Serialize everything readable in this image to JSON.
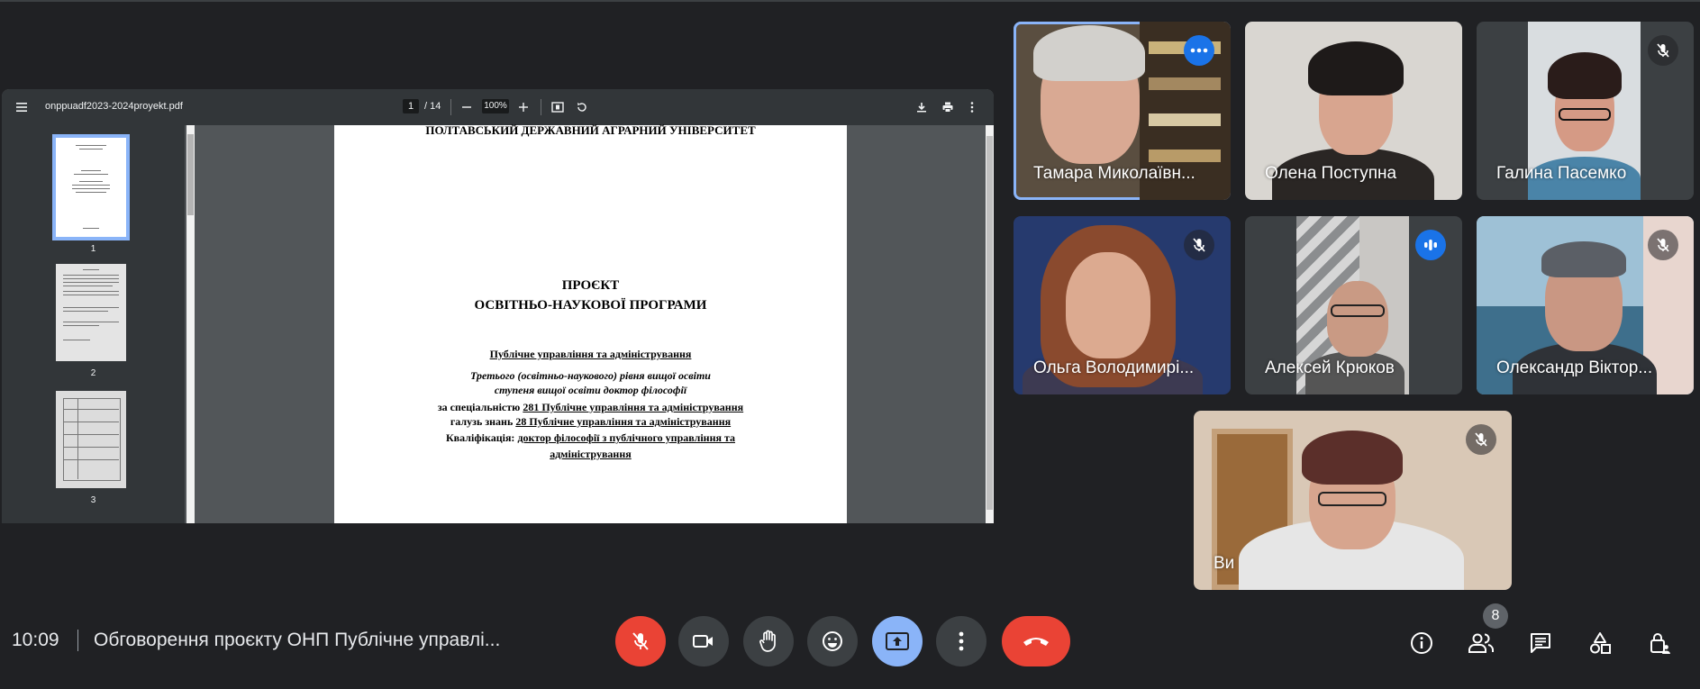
{
  "pdf": {
    "filename": "onppuadf2023-2024proyekt.pdf",
    "current_page": "1",
    "total_pages": "/ 14",
    "zoom": "100%",
    "thumbnails": [
      {
        "label": "1"
      },
      {
        "label": "2"
      },
      {
        "label": "3"
      }
    ],
    "document": {
      "university": "ПОЛТАВСЬКИЙ ДЕРЖАВНИЙ АГРАРНИЙ УНІВЕРСИТЕТ",
      "title_1": "ПРОЄКТ",
      "title_2": "ОСВІТНЬО-НАУКОВОЇ ПРОГРАМИ",
      "program": "Публічне управління та адміністрування",
      "level_1": "Третього (освітньо-наукового) рівня вищої освіти",
      "level_2": "ступеня вищої освіти доктор філософії",
      "spec_prefix": "за спеціальністю ",
      "spec_value": "281 Публічне управління та адміністрування",
      "field_prefix": "галузь знань ",
      "field_value": "28 Публічне управління та адміністрування",
      "qual_prefix": "Кваліфікація: ",
      "qual_value": "доктор філософії з публічного управління та",
      "qual_value_2": "адміністрування"
    }
  },
  "participants": [
    {
      "name": "Тамара Миколаївн..."
    },
    {
      "name": "Олена Поступна"
    },
    {
      "name": "Галина Пасемко"
    },
    {
      "name": "Ольга Володимирі..."
    },
    {
      "name": "Алексей Крюков"
    },
    {
      "name": "Олександр Віктор..."
    },
    {
      "name": "Ви"
    }
  ],
  "meeting": {
    "time": "10:09",
    "title": "Обговорення проєкту ОНП Публічне управлі...",
    "people_count": "8"
  },
  "colors": {
    "background": "#202124",
    "accent_blue": "#8ab4f8",
    "end_call_red": "#ea4335",
    "speaking_blue": "#1a73e8"
  }
}
